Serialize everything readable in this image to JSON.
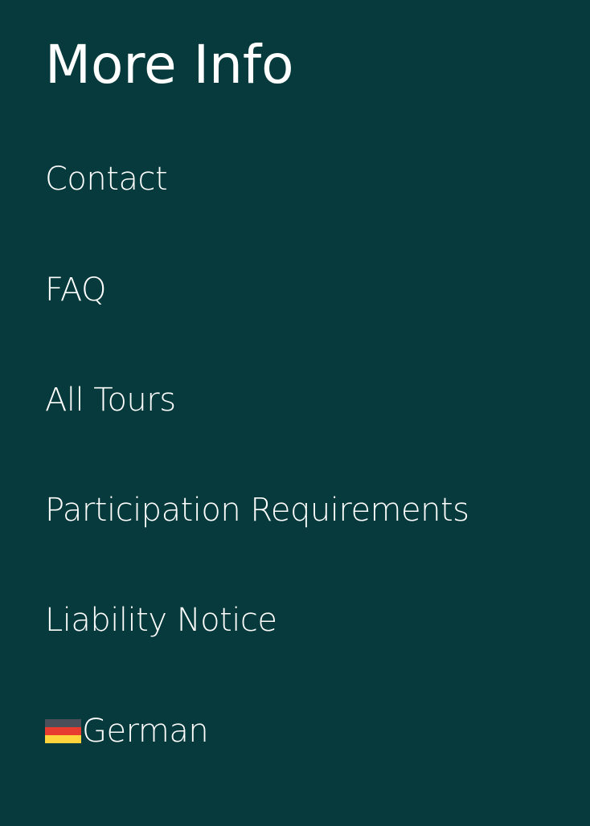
{
  "panel": {
    "title": "More Info"
  },
  "menu": {
    "items": [
      {
        "label": "Contact"
      },
      {
        "label": "FAQ"
      },
      {
        "label": "All Tours"
      },
      {
        "label": "Participation Requirements"
      },
      {
        "label": "Liability Notice"
      }
    ],
    "language": {
      "label": "German",
      "flag_icon": "germany-flag-icon",
      "flag_colors": [
        "#4a4f59",
        "#e63b2e",
        "#ffd33b"
      ]
    }
  },
  "colors": {
    "background": "#073a3c",
    "text": "#ffffff"
  }
}
